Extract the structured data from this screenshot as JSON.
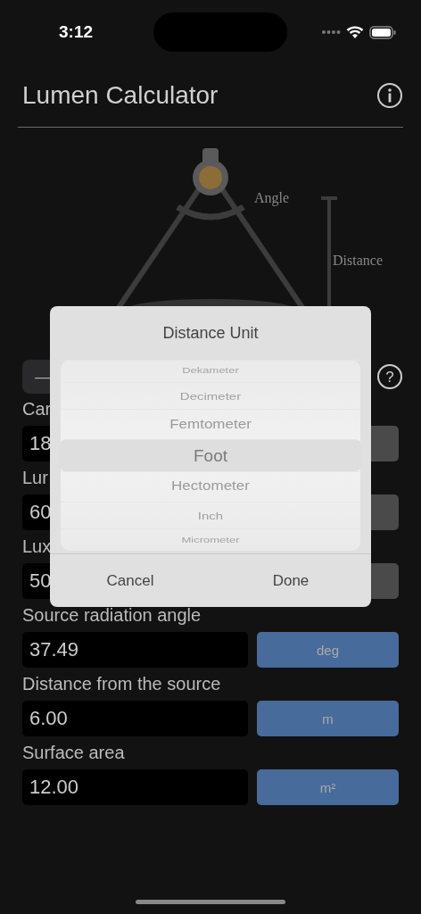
{
  "status_bar": {
    "time": "3:12"
  },
  "header": {
    "title": "Lumen Calculator"
  },
  "diagram": {
    "angle_label": "Angle",
    "distance_label": "Distance"
  },
  "toolbar": {
    "segment": "—",
    "help": "?"
  },
  "fields": [
    {
      "label": "Car",
      "value": "18",
      "disabled": true
    },
    {
      "label": "Lur",
      "value": "60",
      "disabled": true
    },
    {
      "label": "Lux",
      "value": "50",
      "disabled": true
    },
    {
      "label": "Source radiation angle",
      "value": "37.49",
      "unit": "deg",
      "disabled": false
    },
    {
      "label": "Distance from the source",
      "value": "6.00",
      "unit": "m",
      "disabled": false
    },
    {
      "label": "Surface area",
      "value": "12.00",
      "unit": "m²",
      "disabled": false
    }
  ],
  "dialog": {
    "title": "Distance Unit",
    "options": [
      {
        "label": "Dekameter",
        "selected": false
      },
      {
        "label": "Decimeter",
        "selected": false
      },
      {
        "label": "Femtometer",
        "selected": false
      },
      {
        "label": "Foot",
        "selected": true
      },
      {
        "label": "Hectometer",
        "selected": false
      },
      {
        "label": "Inch",
        "selected": false
      },
      {
        "label": "Micrometer",
        "selected": false
      }
    ],
    "buttons": [
      "Cancel",
      "Done"
    ]
  }
}
